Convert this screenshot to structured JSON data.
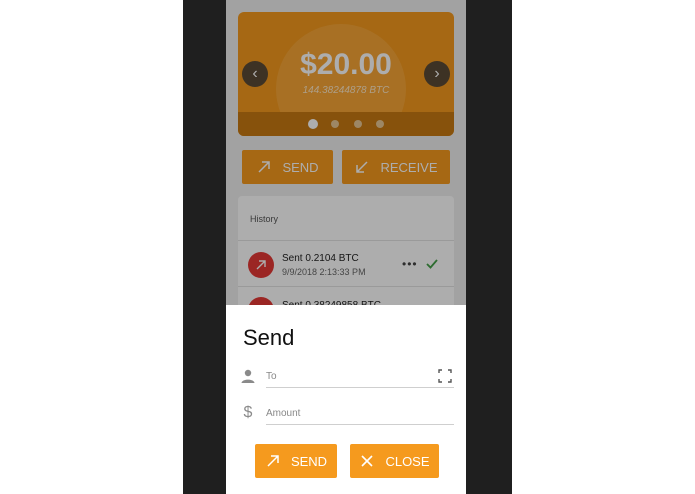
{
  "wallet": {
    "balance_usd": "$20.00",
    "balance_btc": "144.38244878 BTC",
    "carousel": {
      "count": 4,
      "active_index": 0
    },
    "actions": {
      "send_label": "SEND",
      "receive_label": "RECEIVE"
    }
  },
  "history": {
    "title": "History",
    "items": [
      {
        "title": "Sent 0.2104 BTC",
        "timestamp": "9/9/2018 2:13:33 PM",
        "icon": "arrow-up-right-icon",
        "status_icon": "check-icon",
        "menu_icon": "more-horizontal-icon"
      },
      {
        "title": "Sent 0.38249858 BTC",
        "timestamp": "",
        "icon": "arrow-up-right-icon"
      }
    ]
  },
  "send_sheet": {
    "title": "Send",
    "to_field": {
      "placeholder": "To",
      "value": "",
      "icon": "person-icon",
      "scan_icon": "scan-icon"
    },
    "amount_field": {
      "placeholder": "Amount",
      "value": "",
      "icon": "dollar-icon"
    },
    "send_label": "SEND",
    "close_label": "CLOSE"
  },
  "colors": {
    "accent": "#f59a1e",
    "danger": "#e53935",
    "success": "#43a047",
    "frame": "#1f1f1f"
  }
}
